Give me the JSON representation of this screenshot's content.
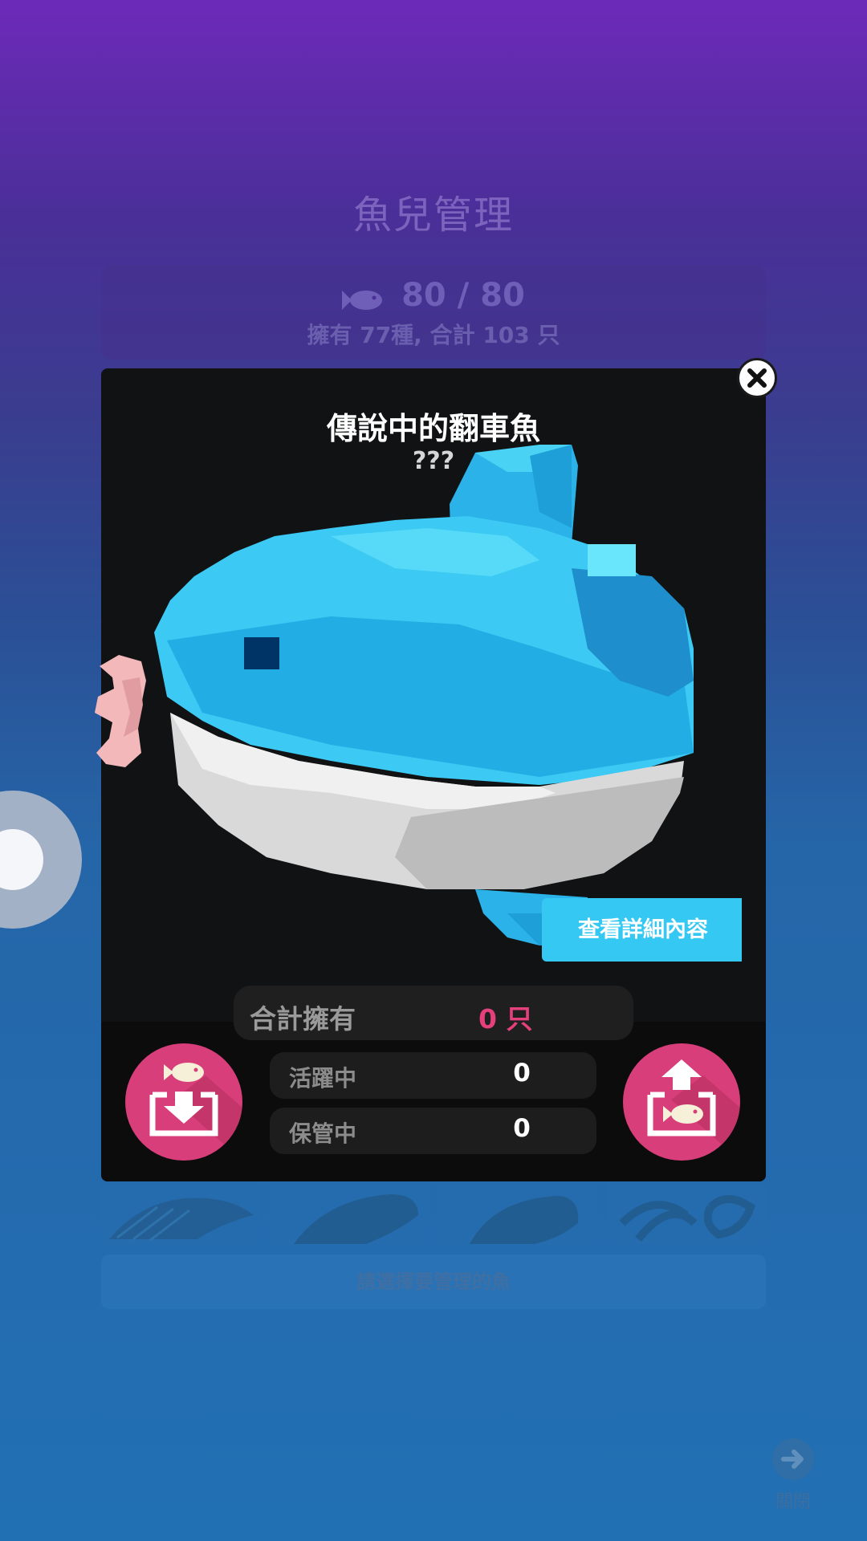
{
  "background": {
    "title": "魚兒管理",
    "fish_count": "80 / 80",
    "summary": "擁有 77種, 合計 103 只",
    "hint": "請選擇要管理的魚",
    "close_label": "關閉"
  },
  "modal": {
    "title": "傳說中的翻車魚",
    "subtitle": "???",
    "detail_button_label": "查看詳細內容",
    "total": {
      "label": "合計擁有",
      "value": "0 只"
    },
    "active": {
      "label": "活躍中",
      "value": "0"
    },
    "stored": {
      "label": "保管中",
      "value": "0"
    }
  },
  "icons": {
    "close": "close-icon",
    "store": "store-fish-icon",
    "release": "release-fish-icon",
    "fish": "fish-icon",
    "arrow_right": "arrow-right-icon"
  },
  "colors": {
    "accent_pink": "#d83e7a",
    "detail_blue": "#35c8f2",
    "modal_bg": "#111213",
    "total_value": "#e53f7c"
  }
}
